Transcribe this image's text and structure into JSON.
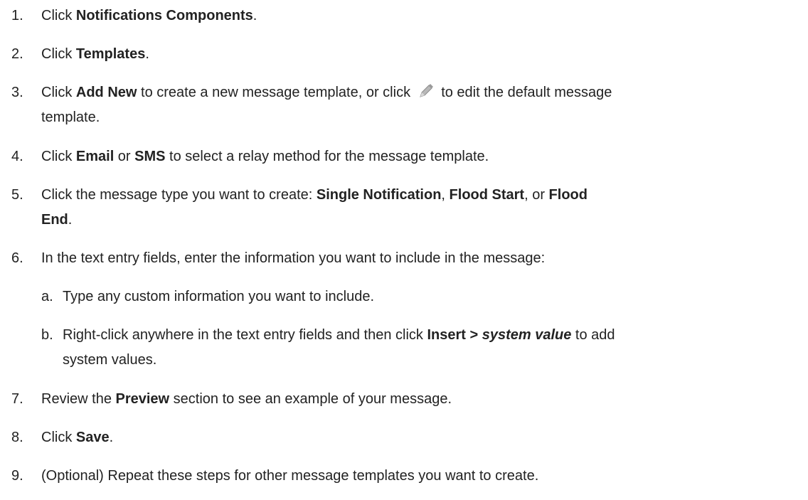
{
  "steps": [
    {
      "n": "1.",
      "pre": "Click ",
      "bold1": "Notifications Components",
      "post": "."
    },
    {
      "n": "2.",
      "pre": "Click ",
      "bold1": "Templates",
      "post": "."
    },
    {
      "n": "3.",
      "pre": "Click ",
      "bold1": "Add New",
      "mid": " to create a new message template, or click ",
      "post": " to edit the default message",
      "line2": "template.",
      "icon": "pencil-icon"
    },
    {
      "n": "4.",
      "pre": "Click ",
      "bold1": "Email",
      "mid": " or ",
      "bold2": "SMS",
      "post": " to select a relay method for the message template."
    },
    {
      "n": "5.",
      "pre": "Click the message type you want to create: ",
      "bold1": "Single Notification",
      "sep1": ", ",
      "bold2": "Flood Start",
      "sep2": ", or ",
      "bold3": "Flood",
      "line2_bold": "End",
      "line2_post": "."
    },
    {
      "n": "6.",
      "text": "In the text entry fields, enter the information you want to include in the message:"
    },
    {
      "n": "7.",
      "pre": "Review the ",
      "bold1": "Preview",
      "post": " section to see an example of your message."
    },
    {
      "n": "8.",
      "pre": "Click ",
      "bold1": "Save",
      "post": "."
    },
    {
      "n": "9.",
      "text": "(Optional) Repeat these steps for other message templates you want to create."
    }
  ],
  "substeps": [
    {
      "n": "a.",
      "text": "Type any custom information you want to include."
    },
    {
      "n": "b.",
      "pre": "Right-click anywhere in the text entry fields and then click ",
      "bold1": "Insert > ",
      "bold_italic": "system value",
      "post": " to add",
      "line2": "system values."
    }
  ]
}
